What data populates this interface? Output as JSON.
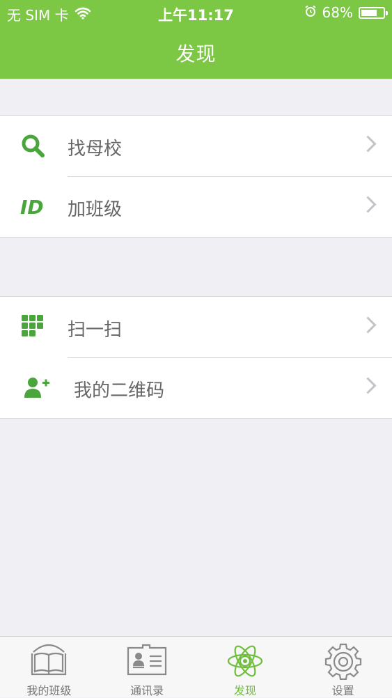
{
  "status_bar": {
    "carrier": "无 SIM 卡",
    "time": "上午11:17",
    "battery": "68%",
    "icons": [
      "wifi-icon",
      "alarm-icon",
      "battery-icon"
    ]
  },
  "header": {
    "title": "发现"
  },
  "groups": [
    {
      "items": [
        {
          "label": "找母校",
          "icon": "search-icon"
        },
        {
          "label": "加班级",
          "icon": "id-icon"
        }
      ]
    },
    {
      "items": [
        {
          "label": "扫一扫",
          "icon": "qr-grid-icon"
        },
        {
          "label": "我的二维码",
          "icon": "add-user-icon"
        }
      ]
    }
  ],
  "tabbar": {
    "tabs": [
      {
        "label": "我的班级",
        "icon": "book-icon",
        "active": false
      },
      {
        "label": "通讯录",
        "icon": "contact-card-icon",
        "active": false
      },
      {
        "label": "发现",
        "icon": "atom-icon",
        "active": true
      },
      {
        "label": "设置",
        "icon": "gear-icon",
        "active": false
      }
    ]
  },
  "colors": {
    "brand": "#7cc744",
    "icon_green": "#4aa53c",
    "background": "#efeff4",
    "chevron": "#c3c3c8"
  }
}
